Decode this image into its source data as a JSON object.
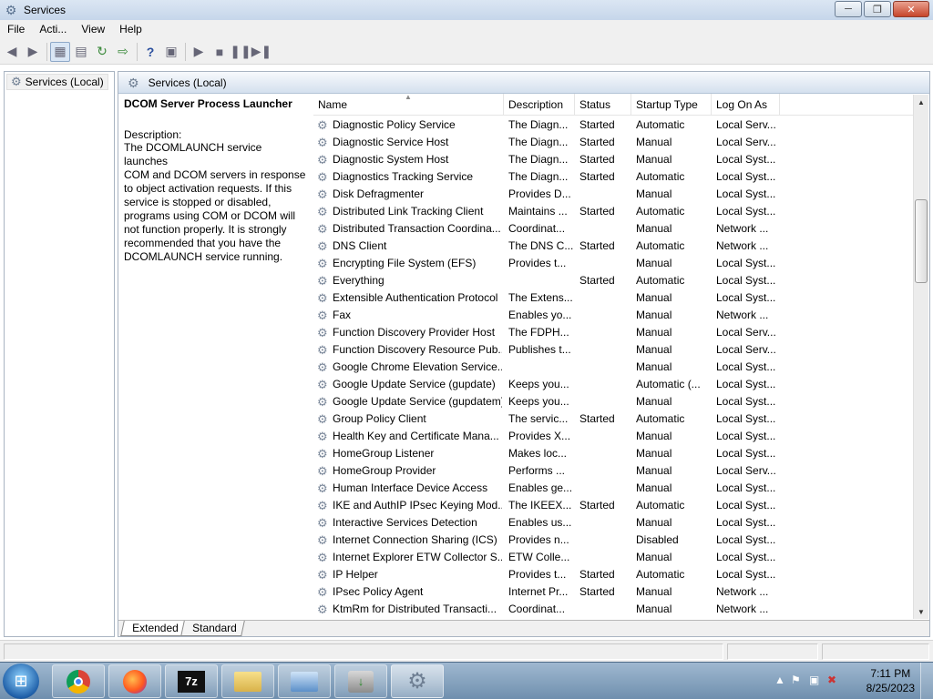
{
  "window": {
    "title": "Services"
  },
  "menu": [
    "File",
    "Acti...",
    "View",
    "Help"
  ],
  "tree": {
    "root_label": "Services (Local)"
  },
  "header": {
    "title": "Services (Local)"
  },
  "description_panel": {
    "service_name": "DCOM Server Process Launcher",
    "label": "Description:",
    "lines": [
      "The DCOMLAUNCH service launches",
      "COM and DCOM servers in response",
      "to object activation requests. If this",
      "service is stopped or disabled,",
      "programs using COM or DCOM will",
      "not function properly. It is strongly",
      "recommended that you have the",
      "DCOMLAUNCH service running."
    ]
  },
  "columns": [
    "Name",
    "Description",
    "Status",
    "Startup Type",
    "Log On As"
  ],
  "services": [
    {
      "name": "Diagnostic Policy Service",
      "desc": "The Diagn...",
      "status": "Started",
      "type": "Automatic",
      "logon": "Local Serv..."
    },
    {
      "name": "Diagnostic Service Host",
      "desc": "The Diagn...",
      "status": "Started",
      "type": "Manual",
      "logon": "Local Serv..."
    },
    {
      "name": "Diagnostic System Host",
      "desc": "The Diagn...",
      "status": "Started",
      "type": "Manual",
      "logon": "Local Syst..."
    },
    {
      "name": "Diagnostics Tracking Service",
      "desc": "The Diagn...",
      "status": "Started",
      "type": "Automatic",
      "logon": "Local Syst..."
    },
    {
      "name": "Disk Defragmenter",
      "desc": "Provides D...",
      "status": "",
      "type": "Manual",
      "logon": "Local Syst..."
    },
    {
      "name": "Distributed Link Tracking Client",
      "desc": "Maintains ...",
      "status": "Started",
      "type": "Automatic",
      "logon": "Local Syst..."
    },
    {
      "name": "Distributed Transaction Coordina...",
      "desc": "Coordinat...",
      "status": "",
      "type": "Manual",
      "logon": "Network ..."
    },
    {
      "name": "DNS Client",
      "desc": "The DNS C...",
      "status": "Started",
      "type": "Automatic",
      "logon": "Network ..."
    },
    {
      "name": "Encrypting File System (EFS)",
      "desc": "Provides t...",
      "status": "",
      "type": "Manual",
      "logon": "Local Syst..."
    },
    {
      "name": "Everything",
      "desc": "",
      "status": "Started",
      "type": "Automatic",
      "logon": "Local Syst..."
    },
    {
      "name": "Extensible Authentication Protocol",
      "desc": "The Extens...",
      "status": "",
      "type": "Manual",
      "logon": "Local Syst..."
    },
    {
      "name": "Fax",
      "desc": "Enables yo...",
      "status": "",
      "type": "Manual",
      "logon": "Network ..."
    },
    {
      "name": "Function Discovery Provider Host",
      "desc": "The FDPH...",
      "status": "",
      "type": "Manual",
      "logon": "Local Serv..."
    },
    {
      "name": "Function Discovery Resource Pub...",
      "desc": "Publishes t...",
      "status": "",
      "type": "Manual",
      "logon": "Local Serv..."
    },
    {
      "name": "Google Chrome Elevation Service...",
      "desc": "",
      "status": "",
      "type": "Manual",
      "logon": "Local Syst..."
    },
    {
      "name": "Google Update Service (gupdate)",
      "desc": "Keeps you...",
      "status": "",
      "type": "Automatic (...",
      "logon": "Local Syst..."
    },
    {
      "name": "Google Update Service (gupdatem)",
      "desc": "Keeps you...",
      "status": "",
      "type": "Manual",
      "logon": "Local Syst..."
    },
    {
      "name": "Group Policy Client",
      "desc": "The servic...",
      "status": "Started",
      "type": "Automatic",
      "logon": "Local Syst..."
    },
    {
      "name": "Health Key and Certificate Mana...",
      "desc": "Provides X...",
      "status": "",
      "type": "Manual",
      "logon": "Local Syst..."
    },
    {
      "name": "HomeGroup Listener",
      "desc": "Makes loc...",
      "status": "",
      "type": "Manual",
      "logon": "Local Syst..."
    },
    {
      "name": "HomeGroup Provider",
      "desc": "Performs ...",
      "status": "",
      "type": "Manual",
      "logon": "Local Serv..."
    },
    {
      "name": "Human Interface Device Access",
      "desc": "Enables ge...",
      "status": "",
      "type": "Manual",
      "logon": "Local Syst..."
    },
    {
      "name": "IKE and AuthIP IPsec Keying Mod...",
      "desc": "The IKEEX...",
      "status": "Started",
      "type": "Automatic",
      "logon": "Local Syst..."
    },
    {
      "name": "Interactive Services Detection",
      "desc": "Enables us...",
      "status": "",
      "type": "Manual",
      "logon": "Local Syst..."
    },
    {
      "name": "Internet Connection Sharing (ICS)",
      "desc": "Provides n...",
      "status": "",
      "type": "Disabled",
      "logon": "Local Syst..."
    },
    {
      "name": "Internet Explorer ETW Collector S...",
      "desc": "ETW Colle...",
      "status": "",
      "type": "Manual",
      "logon": "Local Syst..."
    },
    {
      "name": "IP Helper",
      "desc": "Provides t...",
      "status": "Started",
      "type": "Automatic",
      "logon": "Local Syst..."
    },
    {
      "name": "IPsec Policy Agent",
      "desc": "Internet Pr...",
      "status": "Started",
      "type": "Manual",
      "logon": "Network ..."
    },
    {
      "name": "KtmRm for Distributed Transacti...",
      "desc": "Coordinat...",
      "status": "",
      "type": "Manual",
      "logon": "Network ..."
    }
  ],
  "tabs": [
    "Extended",
    "Standard"
  ],
  "taskbar": {
    "apps": [
      {
        "icon": "chrome-icon",
        "label": ""
      },
      {
        "icon": "firefox-icon",
        "label": ""
      },
      {
        "icon": "7zip-icon",
        "label": "7z"
      },
      {
        "icon": "folder-icon",
        "label": ""
      },
      {
        "icon": "control-panel-icon",
        "label": ""
      },
      {
        "icon": "installer-icon",
        "label": ""
      },
      {
        "icon": "services-icon",
        "label": ""
      }
    ],
    "time": "7:11 PM",
    "date": "8/25/2023"
  },
  "colors": {
    "titlebar": "#c6d6ea",
    "close_button": "#c7452b",
    "taskbar": "#7f9dbb",
    "list_header_bg": "#d4e0ee"
  }
}
